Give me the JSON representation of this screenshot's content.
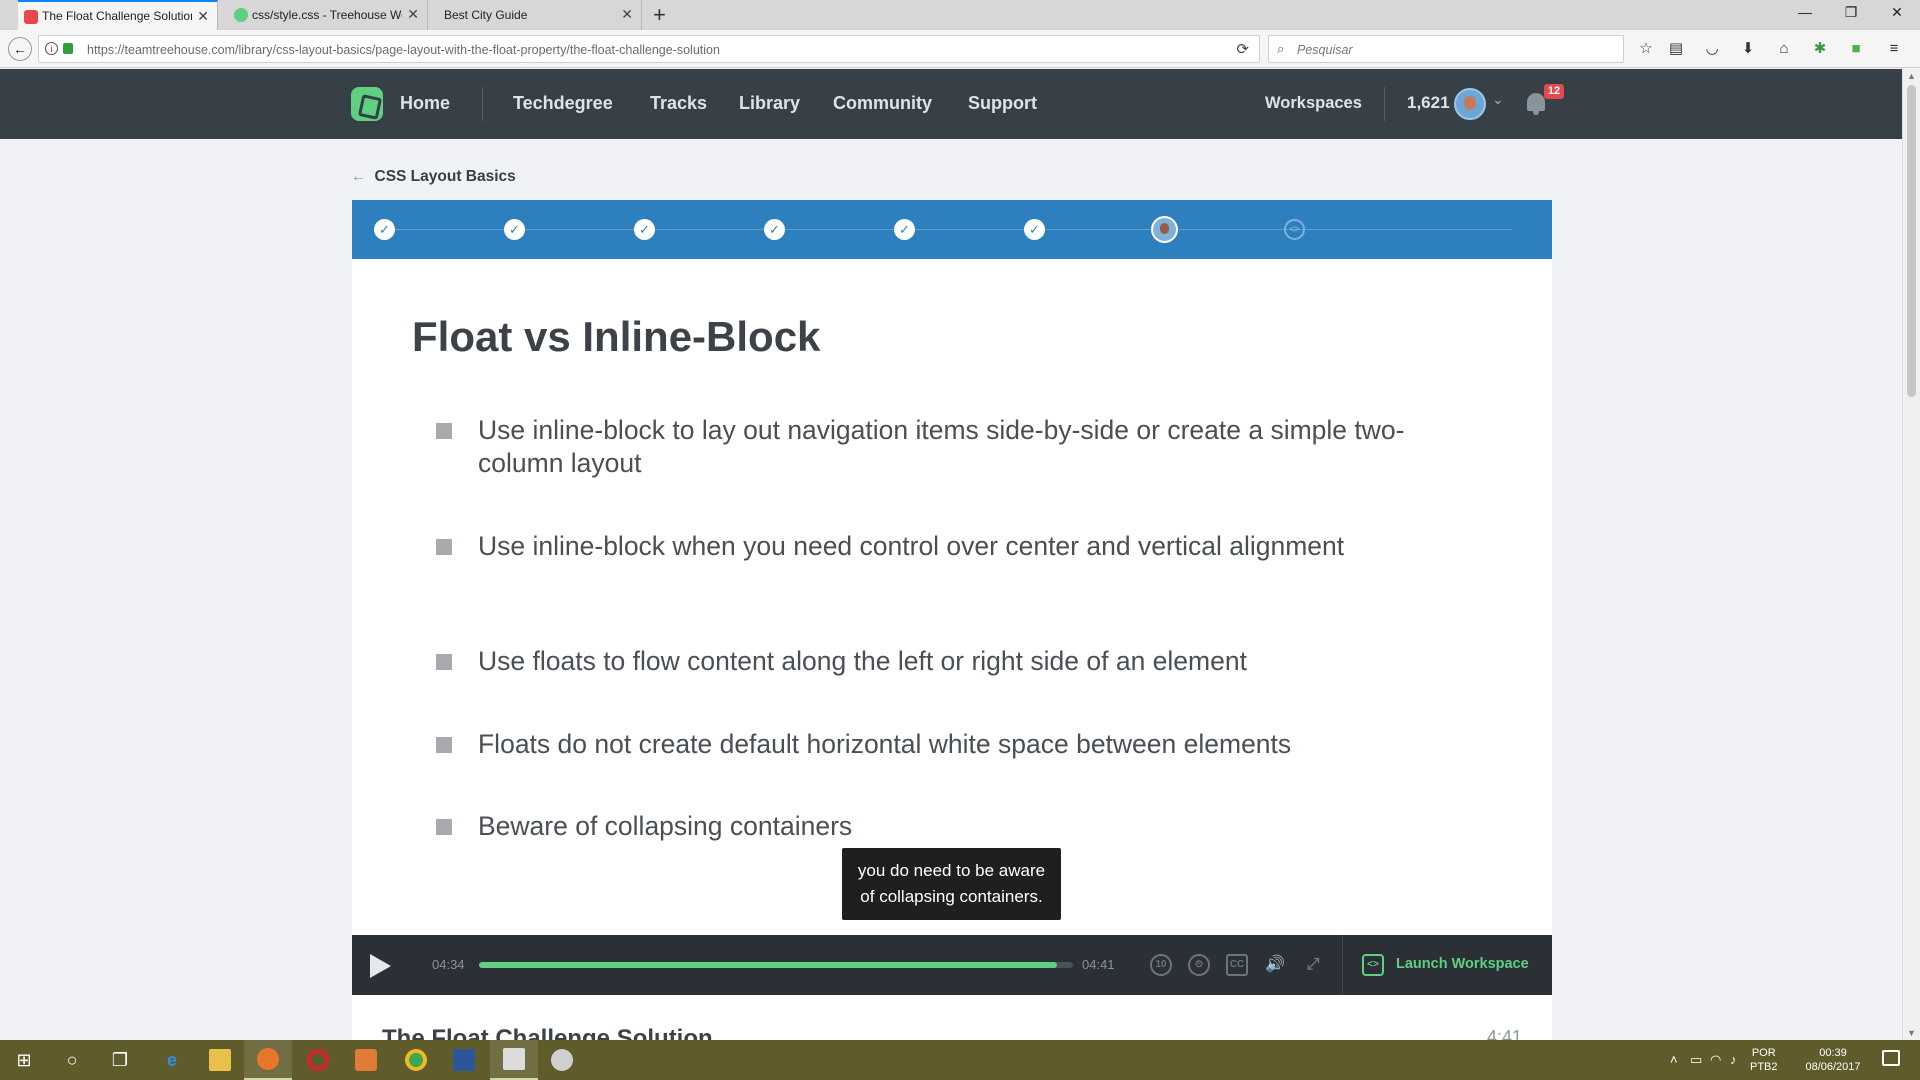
{
  "browser": {
    "tabs": [
      {
        "title": "The Float Challenge Solution",
        "favicon_color": "#e5484d",
        "active": true
      },
      {
        "title": "css/style.css - Treehouse Wo",
        "favicon_color": "#5fcf80",
        "active": false
      },
      {
        "title": "Best City Guide",
        "favicon_color": "",
        "active": false
      }
    ],
    "url": "https://teamtreehouse.com/library/css-layout-basics/page-layout-with-the-float-property/the-float-challenge-solution",
    "search_placeholder": "Pesquisar"
  },
  "site_nav": {
    "home": "Home",
    "links": [
      "Techdegree",
      "Tracks",
      "Library",
      "Community",
      "Support"
    ],
    "workspaces": "Workspaces",
    "points": "1,621",
    "notifications": "12"
  },
  "breadcrumb": "CSS Layout Basics",
  "progress": {
    "steps": [
      "complete",
      "complete",
      "complete",
      "complete",
      "complete",
      "complete",
      "current",
      "pending"
    ]
  },
  "slide": {
    "title": "Float vs Inline-Block",
    "bullets": [
      "Use inline-block to lay out navigation items side-by-side or create a simple two-column layout",
      "Use inline-block when you need control over center and vertical alignment",
      "Use floats to flow content along the left or right side of an element",
      "Floats do not create default horizontal white space between elements",
      "Beware of collapsing containers"
    ]
  },
  "caption": "you do need to be aware\nof collapsing containers.",
  "player": {
    "current_time": "04:34",
    "total_time": "04:41",
    "progress_fraction": 0.973,
    "launch_workspace": "Launch Workspace"
  },
  "below_player": {
    "video_title": "The Float Challenge Solution",
    "duration": "4:41"
  },
  "taskbar": {
    "lang": "POR",
    "lang2": "PTB2",
    "time": "00:39",
    "date": "08/06/2017"
  },
  "colors": {
    "accent_green": "#5fcf80",
    "progress_blue": "#2e7fbd",
    "header_dark": "#384047"
  }
}
